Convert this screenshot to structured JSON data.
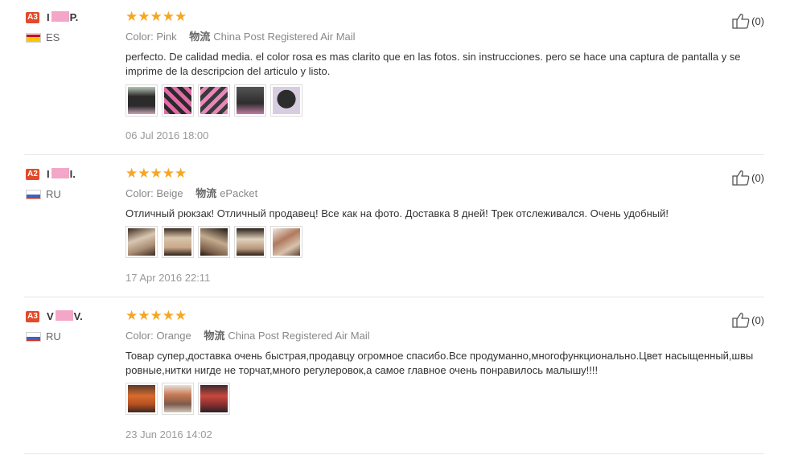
{
  "reviews": [
    {
      "level": "A3",
      "level_color": "#e24a2a",
      "name_first": "I",
      "name_last": "P.",
      "country": "ES",
      "flag": "spain-flag-icon",
      "stars": "★★★★★",
      "color_label": "Color:",
      "color_value": "Pink",
      "ship_label": "物流",
      "ship_value": "China Post Registered Air Mail",
      "text": "perfecto. De calidad media. el color rosa es mas clarito que en las fotos. sin instrucciones. pero se hace una captura de pantalla y se imprime de la descripcion del articulo y listo.",
      "date": "06 Jul 2016 18:00",
      "likes": "(0)"
    },
    {
      "level": "A2",
      "level_color": "#e24a2a",
      "name_first": "I",
      "name_last": "I.",
      "country": "RU",
      "flag": "russia-flag-icon",
      "stars": "★★★★★",
      "color_label": "Color:",
      "color_value": "Beige",
      "ship_label": "物流",
      "ship_value": "ePacket",
      "text": "Отличный рюкзак! Отличный продавец! Все как на фото. Доставка 8 дней! Трек отслеживался. Очень удобный!",
      "date": "17 Apr 2016 22:11",
      "likes": "(0)"
    },
    {
      "level": "A3",
      "level_color": "#e24a2a",
      "name_first": "V",
      "name_last": "V.",
      "country": "RU",
      "flag": "russia-flag-icon",
      "stars": "★★★★★",
      "color_label": "Color:",
      "color_value": "Orange",
      "ship_label": "物流",
      "ship_value": "China Post Registered Air Mail",
      "text": "Товар супер,доставка очень быстрая,продавцу огромное спасибо.Все продуманно,многофункционально.Цвет насыщенный,швы ровные,нитки нигде не торчат,много регулеровок,а самое главное очень понравилось малышу!!!!",
      "date": "23 Jun 2016 14:02",
      "likes": "(0)"
    }
  ],
  "colors": {
    "star": "#f5a623",
    "level_badge": "#e24a2a",
    "name_mask": "#f4a6c8",
    "divider": "#e6e6e6"
  }
}
